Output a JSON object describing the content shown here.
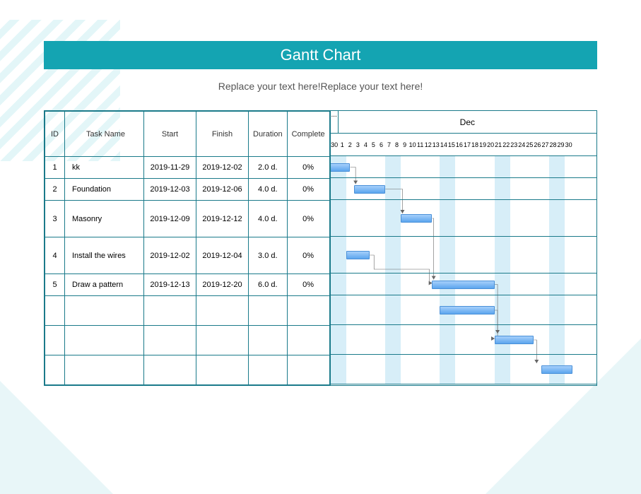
{
  "title": "Gantt Chart",
  "subtitle": "Replace your text here!Replace your text here!",
  "columns": {
    "id": "ID",
    "name": "Task Name",
    "start": "Start",
    "finish": "Finish",
    "duration": "Duration",
    "complete": "Complete"
  },
  "months": {
    "prev_marker": "...",
    "current": "Dec"
  },
  "timeline_start_date": "2019-11-30",
  "timeline_days": [
    30,
    1,
    2,
    3,
    4,
    5,
    6,
    7,
    8,
    9,
    10,
    11,
    12,
    13,
    14,
    15,
    16,
    17,
    18,
    19,
    20,
    21,
    22,
    23,
    24,
    25,
    26,
    27,
    28,
    29,
    30
  ],
  "weekend_indices": [
    0,
    1,
    7,
    8,
    14,
    15,
    21,
    22,
    28,
    29
  ],
  "tasks": [
    {
      "id": "1",
      "name": "kk",
      "start": "2019-11-29",
      "finish": "2019-12-02",
      "duration": "2.0 d.",
      "complete": "0%"
    },
    {
      "id": "2",
      "name": "Foundation",
      "start": "2019-12-03",
      "finish": "2019-12-06",
      "duration": "4.0 d.",
      "complete": "0%"
    },
    {
      "id": "3",
      "name": "Masonry",
      "start": "2019-12-09",
      "finish": "2019-12-12",
      "duration": "4.0 d.",
      "complete": "0%"
    },
    {
      "id": "4",
      "name": "Install the wires",
      "start": "2019-12-02",
      "finish": "2019-12-04",
      "duration": "3.0 d.",
      "complete": "0%"
    },
    {
      "id": "5",
      "name": "Draw a pattern",
      "start": "2019-12-13",
      "finish": "2019-12-20",
      "duration": "6.0 d.",
      "complete": "0%"
    }
  ],
  "bars": [
    {
      "row": 0,
      "start_idx": -1,
      "span": 3.5
    },
    {
      "row": 1,
      "start_idx": 3,
      "span": 4
    },
    {
      "row": 2,
      "start_idx": 9,
      "span": 4
    },
    {
      "row": 3,
      "start_idx": 2,
      "span": 3
    },
    {
      "row": 4,
      "start_idx": 13,
      "span": 8
    },
    {
      "row": 5,
      "start_idx": 14,
      "span": 7
    },
    {
      "row": 6,
      "start_idx": 21,
      "span": 5
    },
    {
      "row": 7,
      "start_idx": 27,
      "span": 4
    }
  ],
  "chart_data": {
    "type": "gantt",
    "title": "Gantt Chart",
    "time_axis": {
      "start": "2019-11-30",
      "end": "2019-12-30",
      "unit": "day"
    },
    "series": [
      {
        "id": 1,
        "name": "kk",
        "start": "2019-11-29",
        "end": "2019-12-02",
        "duration_days": 2,
        "percent_complete": 0
      },
      {
        "id": 2,
        "name": "Foundation",
        "start": "2019-12-03",
        "end": "2019-12-06",
        "duration_days": 4,
        "percent_complete": 0,
        "depends_on": [
          1
        ]
      },
      {
        "id": 3,
        "name": "Masonry",
        "start": "2019-12-09",
        "end": "2019-12-12",
        "duration_days": 4,
        "percent_complete": 0,
        "depends_on": [
          2
        ]
      },
      {
        "id": 4,
        "name": "Install the wires",
        "start": "2019-12-02",
        "end": "2019-12-04",
        "duration_days": 3,
        "percent_complete": 0
      },
      {
        "id": 5,
        "name": "Draw a pattern",
        "start": "2019-12-13",
        "end": "2019-12-20",
        "duration_days": 6,
        "percent_complete": 0,
        "depends_on": [
          3
        ]
      }
    ]
  }
}
